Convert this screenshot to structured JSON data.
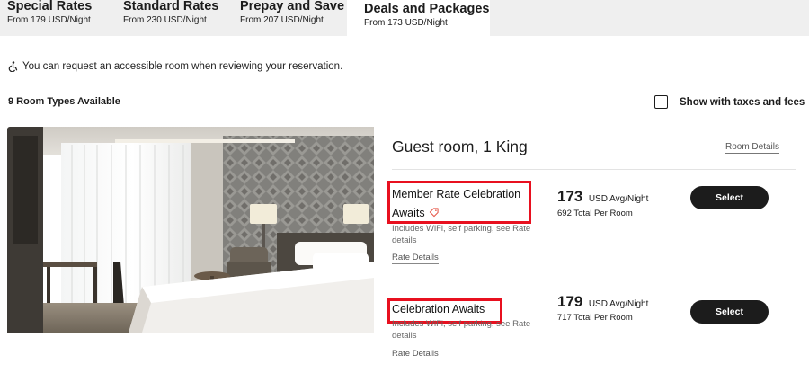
{
  "tabs": [
    {
      "title": "Special Rates",
      "subtitle": "From 179 USD/Night"
    },
    {
      "title": "Standard Rates",
      "subtitle": "From 230 USD/Night"
    },
    {
      "title": "Prepay and Save",
      "subtitle": "From 207 USD/Night"
    },
    {
      "title": "Deals and Packages",
      "subtitle": "From 173 USD/Night"
    }
  ],
  "active_tab": "Deals and Packages",
  "accessible_note": "You can request an accessible room when reviewing your reservation.",
  "room_count": "9 Room Types Available",
  "tax_toggle": {
    "label": "Show with taxes and fees",
    "checked": false
  },
  "room": {
    "title": "Guest room, 1 King",
    "details_link": "Room Details",
    "rates": [
      {
        "name_line1": "Member Rate Celebration",
        "name_line2": "Awaits",
        "has_tag_icon": true,
        "description": "Includes WiFi, self parking, see Rate details",
        "details_link": "Rate Details",
        "price": "173",
        "price_unit": "USD Avg/Night",
        "total": "692 Total Per Room",
        "select_label": "Select"
      },
      {
        "name_line1": "Celebration Awaits",
        "name_line2": "",
        "has_tag_icon": false,
        "description": "Includes WiFi, self parking, see Rate details",
        "details_link": "Rate Details",
        "price": "179",
        "price_unit": "USD Avg/Night",
        "total": "717 Total Per Room",
        "select_label": "Select"
      }
    ]
  },
  "colors": {
    "highlight": "#e8101f",
    "button": "#1c1c1c",
    "tab_bar": "#efefef"
  },
  "icons": {
    "accessible": "wheelchair-icon",
    "rate_tag": "tag-icon"
  }
}
